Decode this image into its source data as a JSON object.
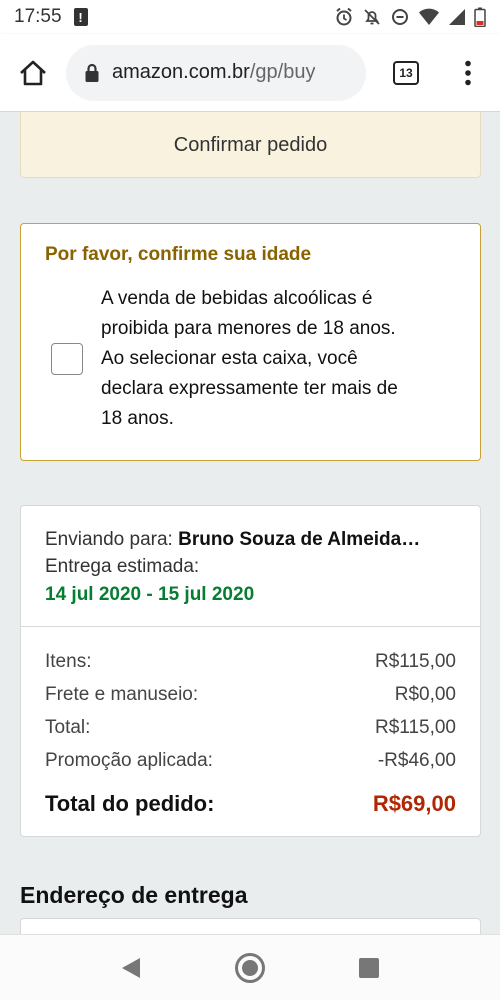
{
  "status_bar": {
    "time": "17:55",
    "alert_glyph": "!",
    "icons": [
      "alarm-icon",
      "notifications-off-icon",
      "do-not-disturb-icon",
      "wifi-icon",
      "signal-icon",
      "battery-icon"
    ]
  },
  "browser": {
    "domain": "amazon.com.br",
    "path": "/gp/buy",
    "tab_count": "13",
    "icons": [
      "home-icon",
      "lock-icon",
      "tab-switcher-icon",
      "more-menu-icon"
    ]
  },
  "page": {
    "confirm_button_label": "Confirmar pedido",
    "age_check": {
      "title": "Por favor, confirme sua idade",
      "lines": [
        "A venda de bebidas alcoólicas é",
        "proibida para menores de 18 anos.",
        "Ao selecionar esta caixa, você",
        "declara expressamente ter mais de",
        "18 anos."
      ],
      "checked": false
    },
    "shipping": {
      "sending_to_label": "Enviando para:",
      "recipient": "Bruno Souza de Almeida…",
      "estimated_label": "Entrega estimada:",
      "delivery_range": "14 jul 2020 - 15 jul 2020"
    },
    "totals": {
      "items_label": "Itens:",
      "items_value": "R$115,00",
      "shipping_label": "Frete e manuseio:",
      "shipping_value": "R$0,00",
      "total_label": "Total:",
      "total_value": "R$115,00",
      "promo_label": "Promoção aplicada:",
      "promo_value": "-R$46,00",
      "order_total_label": "Total do pedido:",
      "order_total_value": "R$69,00"
    },
    "address_heading": "Endereço de entrega"
  },
  "colors": {
    "age_title": "#8a6300",
    "age_border": "#c9a235",
    "delivery_date": "#067d30",
    "order_total": "#b12704",
    "confirm_button_bg": "#f9f2df"
  },
  "nav_bar": {
    "icons": [
      "back-icon",
      "home-circle-icon",
      "recents-icon"
    ]
  }
}
